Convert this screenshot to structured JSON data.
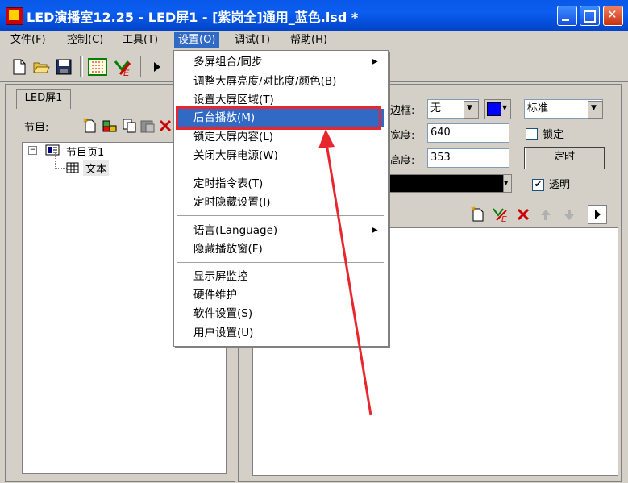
{
  "window": {
    "title": "LED演播室12.25 - LED屏1 - [紫岗全]通用_蓝色.lsd *"
  },
  "menubar": [
    "文件(F)",
    "控制(C)",
    "工具(T)",
    "设置(O)",
    "调试(T)",
    "帮助(H)"
  ],
  "left_panel": {
    "tab": "LED屏1",
    "program_label": "节目:",
    "tree": {
      "page": "节目页1",
      "child": "文本"
    }
  },
  "right_panel": {
    "border_label": "边框:",
    "border_value": "无",
    "style_value": "标准",
    "width_label": "宽度:",
    "width_value": "640",
    "height_label": "高度:",
    "height_value": "353",
    "lock_label": "锁定",
    "timer_button": "定时",
    "transparent_label": "透明",
    "transparent_checked": true
  },
  "dropdown": {
    "items": [
      "多屏组合/同步",
      "调整大屏亮度/对比度/颜色(B)",
      "设置大屏区域(T)",
      "后台播放(M)",
      "锁定大屏内容(L)",
      "关闭大屏电源(W)",
      "定时指令表(T)",
      "定时隐藏设置(I)",
      "语言(Language)",
      "隐藏播放窗(F)",
      "显示屏监控",
      "硬件维护",
      "软件设置(S)",
      "用户设置(U)"
    ],
    "highlighted": "后台播放(M)"
  },
  "colors": {
    "titlebar": "#0b5df0",
    "highlight": "#316ac5",
    "annotation": "#e8262e",
    "border_color": "#0000ff"
  }
}
